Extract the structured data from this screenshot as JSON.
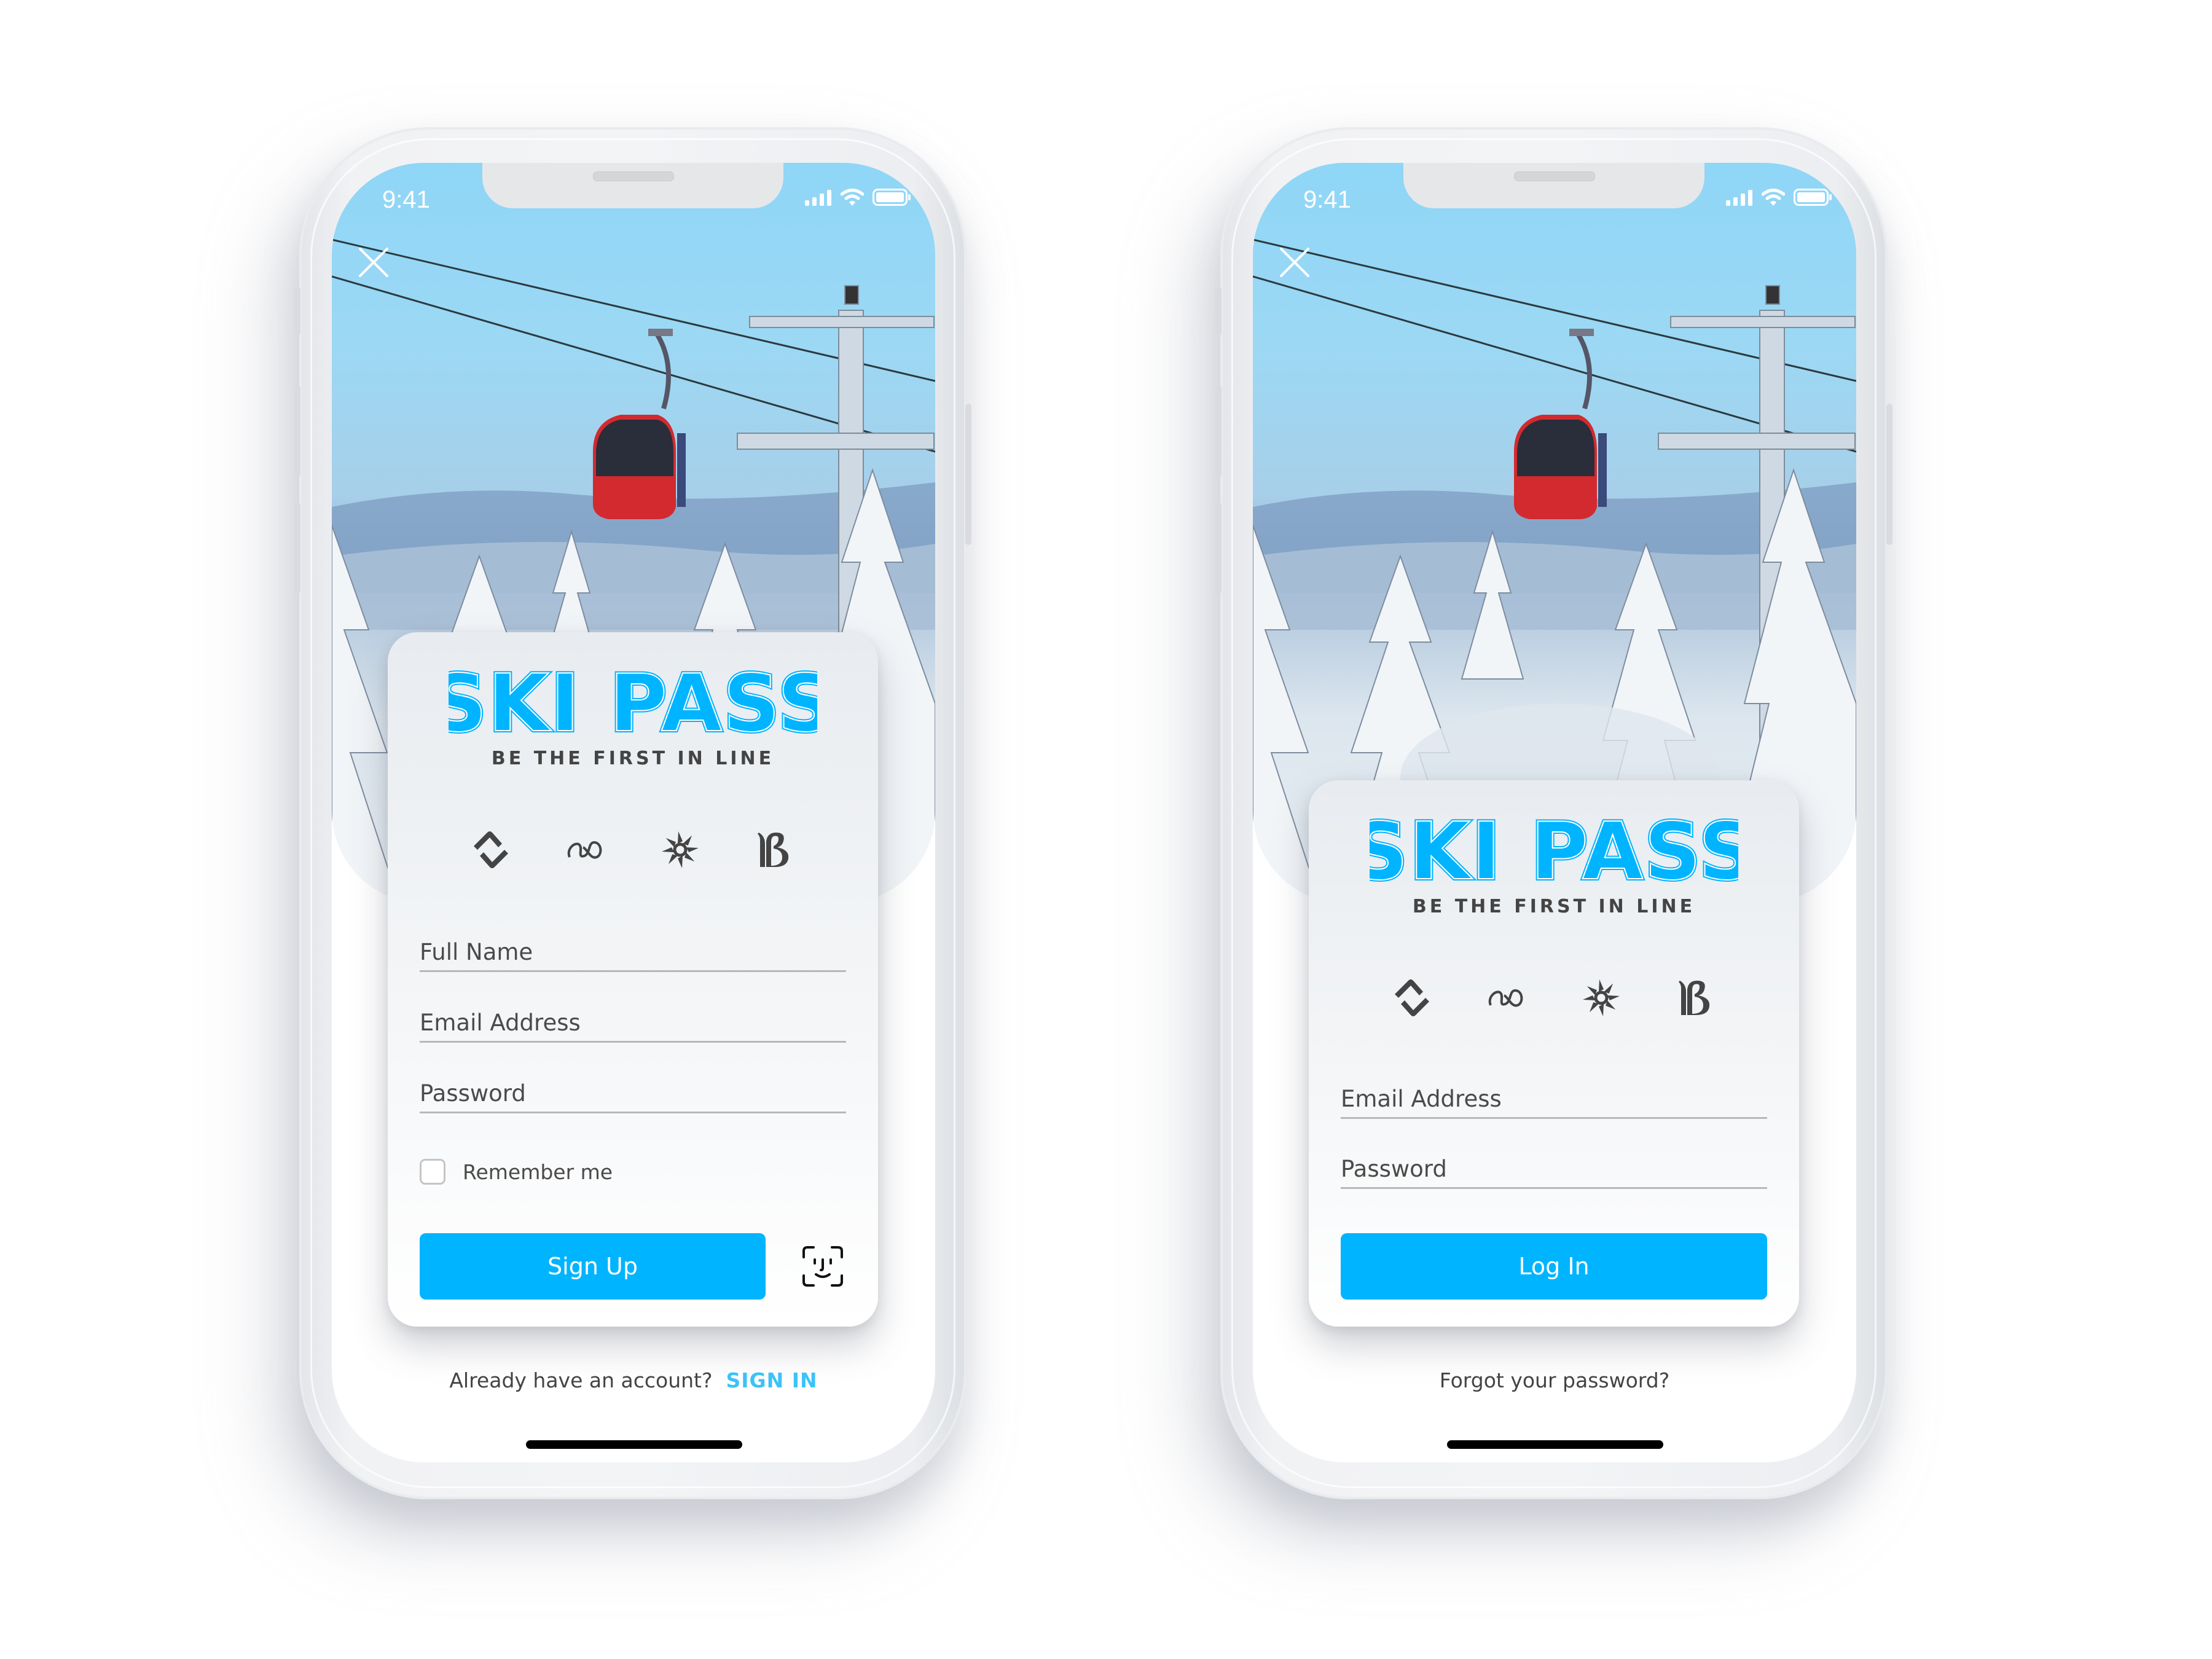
{
  "accent_color": "#00b4ff",
  "status_bar": {
    "time": "9:41",
    "icons": [
      "signal-bars-icon",
      "wifi-icon",
      "battery-icon"
    ]
  },
  "brand": {
    "title": "SKI PASS",
    "tagline": "BE THE FIRST IN LINE"
  },
  "resorts": [
    {
      "icon": "diamond-wave-resort-icon"
    },
    {
      "icon": "triple-loop-resort-icon"
    },
    {
      "icon": "snowflake-star-resort-icon"
    },
    {
      "icon": "b-monogram-resort-icon"
    }
  ],
  "signup_screen": {
    "fields": [
      {
        "placeholder": "Full Name",
        "value": ""
      },
      {
        "placeholder": "Email Address",
        "value": ""
      },
      {
        "placeholder": "Password",
        "value": ""
      }
    ],
    "remember_me": {
      "label": "Remember me",
      "checked": false
    },
    "primary_button": "Sign Up",
    "face_id_icon": "face-id-icon",
    "footer_text": "Already have an account?",
    "footer_link": "SIGN IN"
  },
  "login_screen": {
    "fields": [
      {
        "placeholder": "Email Address",
        "value": ""
      },
      {
        "placeholder": "Password",
        "value": ""
      }
    ],
    "primary_button": "Log In",
    "footer_text": "Forgot your password?"
  }
}
